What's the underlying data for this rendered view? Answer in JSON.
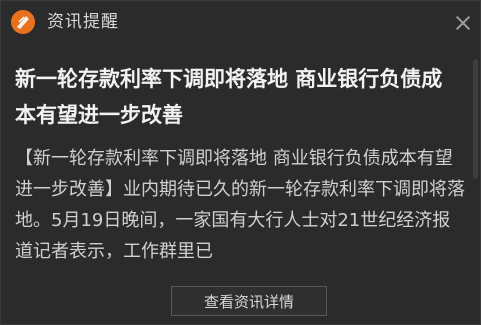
{
  "window": {
    "title": "资讯提醒",
    "logo_icon": "app-logo-icon",
    "close_icon": "close-icon"
  },
  "news": {
    "headline": "新一轮存款利率下调即将落地 商业银行负债成本有望进一步改善",
    "body": "【新一轮存款利率下调即将落地 商业银行负债成本有望进一步改善】业内期待已久的新一轮存款利率下调即将落地。5月19日晚间，一家国有大行人士对21世纪经济报道记者表示，工作群里已"
  },
  "footer": {
    "detail_button_label": "查看资讯详情"
  },
  "colors": {
    "background": "#2b2b2b",
    "accent": "#e8711f",
    "headline": "#f2f2f2",
    "body": "#d0d0d0"
  }
}
